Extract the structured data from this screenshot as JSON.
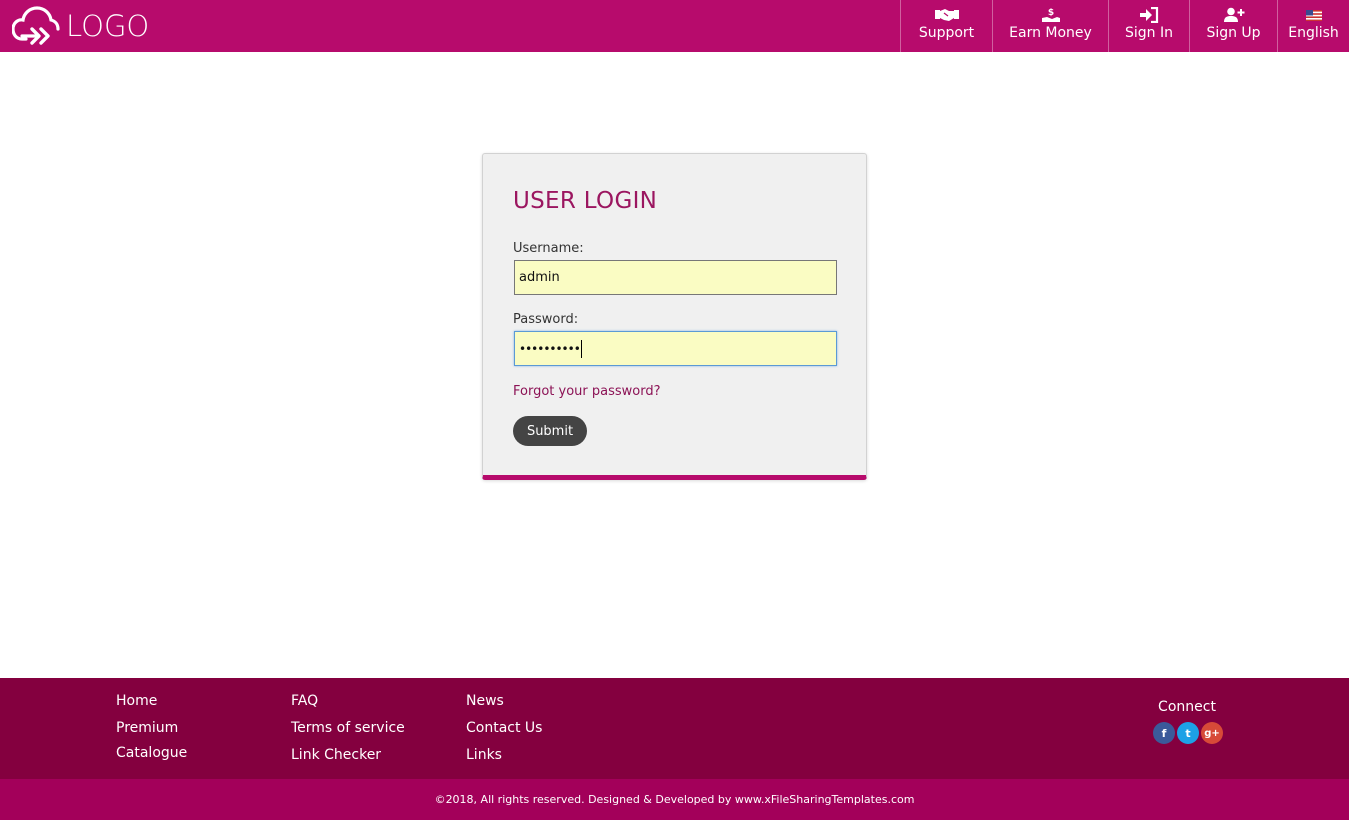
{
  "header": {
    "logo_text": "LOGO",
    "nav": [
      {
        "label": "Support",
        "icon": "handshake-icon"
      },
      {
        "label": "Earn Money",
        "icon": "hand-money-icon"
      },
      {
        "label": "Sign In",
        "icon": "sign-in-icon"
      },
      {
        "label": "Sign Up",
        "icon": "user-plus-icon"
      },
      {
        "label": "English",
        "icon": "us-flag-icon"
      }
    ]
  },
  "login": {
    "title": "USER LOGIN",
    "username_label": "Username:",
    "username_value": "admin",
    "password_label": "Password:",
    "password_value": "••••••••••",
    "forgot_label": "Forgot your password?",
    "submit_label": "Submit"
  },
  "footer": {
    "col1": [
      "Home",
      "Premium",
      "Catalogue"
    ],
    "col2": [
      "FAQ",
      "Terms of service",
      "Link Checker"
    ],
    "col3": [
      "News",
      "Contact Us",
      "Links"
    ],
    "connect_label": "Connect",
    "social": [
      {
        "name": "facebook-icon",
        "glyph": "f"
      },
      {
        "name": "twitter-icon",
        "glyph": "t"
      },
      {
        "name": "google-plus-icon",
        "glyph": "g+"
      }
    ],
    "copyright": "©2018, All rights reserved. Designed & Developed by www.xFileSharingTemplates.com"
  },
  "colors": {
    "brand": "#b70b6c",
    "footer": "#84003f",
    "copyright_bar": "#a3005a",
    "title": "#9b1660",
    "input_bg": "#fafcc3"
  }
}
